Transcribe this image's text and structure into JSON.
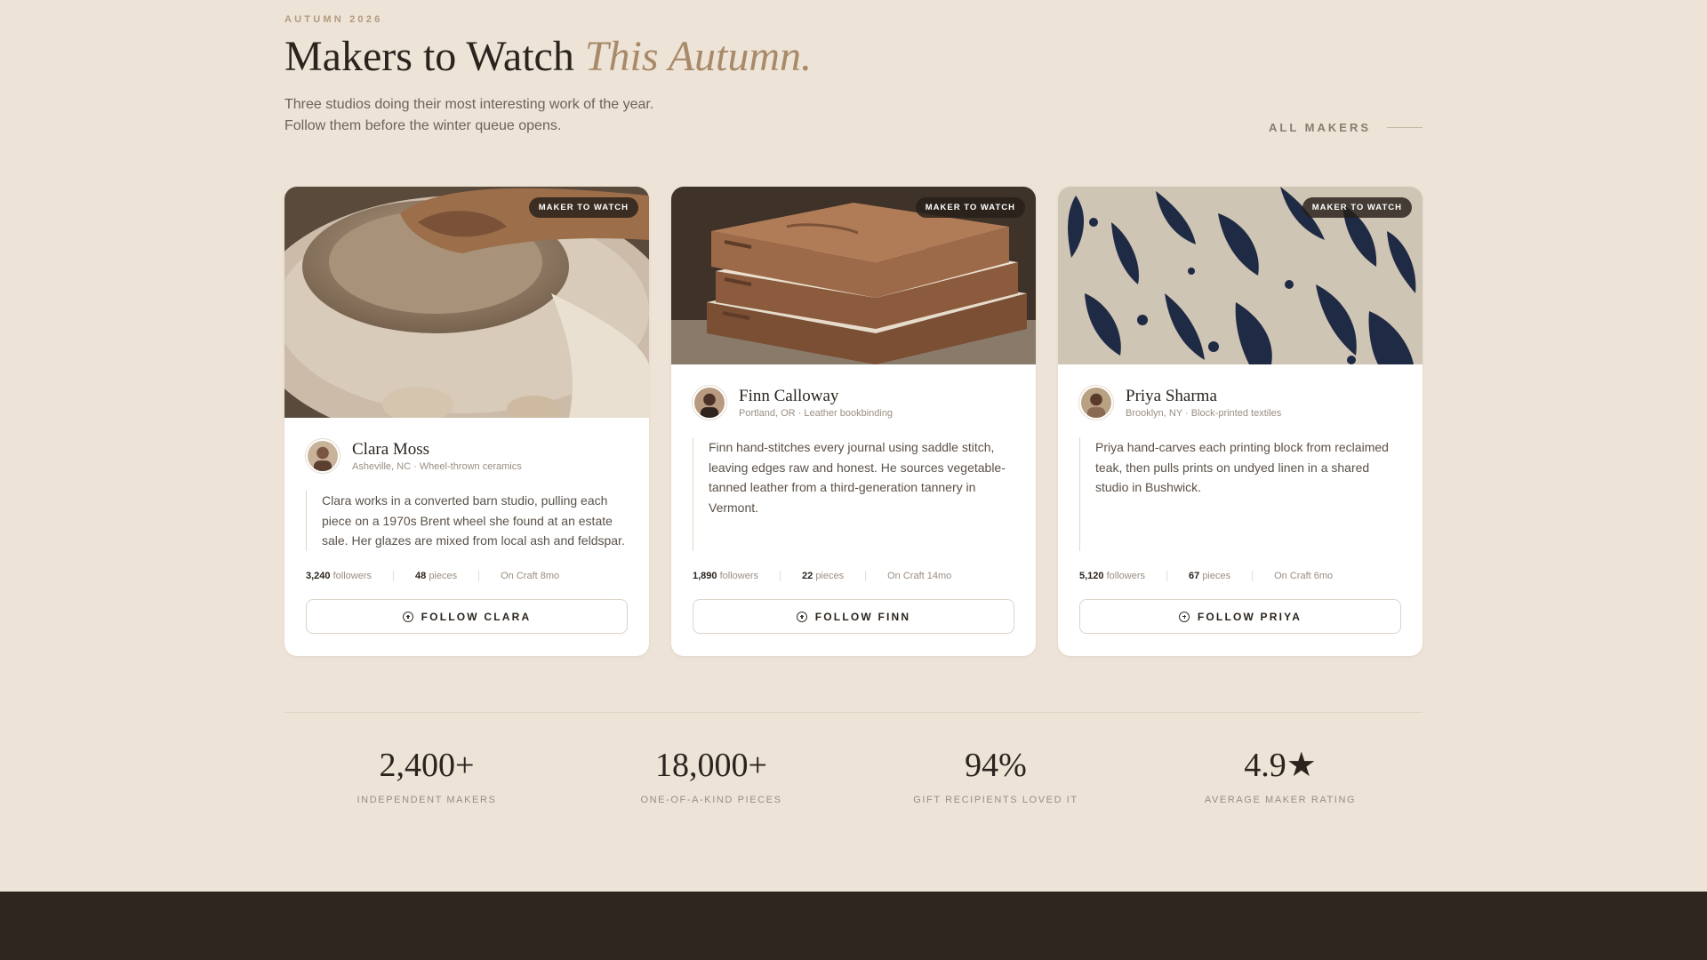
{
  "header": {
    "eyebrow": "AUTUMN 2026",
    "title_main": "Makers to Watch",
    "title_accent": "This Autumn.",
    "subtitle_line1": "Three studios doing their most interesting work of the year.",
    "subtitle_line2": "Follow them before the winter queue opens.",
    "all_makers_label": "ALL MAKERS"
  },
  "cards": [
    {
      "badge": "MAKER TO WATCH",
      "image": "pottery-wheel-photo",
      "name": "Clara Moss",
      "meta": "Asheville, NC · Wheel-thrown ceramics",
      "quote": "Clara works in a converted barn studio, pulling each piece on a 1970s Brent wheel she found at an estate sale. Her glazes are mixed from local ash and feldspar.",
      "followers": "3,240",
      "followers_label": "followers",
      "pieces": "48",
      "pieces_label": "pieces",
      "tenure": "On Craft 8mo",
      "follow_label": "FOLLOW CLARA"
    },
    {
      "badge": "MAKER TO WATCH",
      "image": "leather-books-photo",
      "name": "Finn Calloway",
      "meta": "Portland, OR · Leather bookbinding",
      "quote": "Finn hand-stitches every journal using saddle stitch, leaving edges raw and honest. He sources vegetable-tanned leather from a third-generation tannery in Vermont.",
      "followers": "1,890",
      "followers_label": "followers",
      "pieces": "22",
      "pieces_label": "pieces",
      "tenure": "On Craft 14mo",
      "follow_label": "FOLLOW FINN"
    },
    {
      "badge": "MAKER TO WATCH",
      "image": "block-print-fabric-photo",
      "name": "Priya Sharma",
      "meta": "Brooklyn, NY · Block-printed textiles",
      "quote": "Priya hand-carves each printing block from reclaimed teak, then pulls prints on undyed linen in a shared studio in Bushwick.",
      "followers": "5,120",
      "followers_label": "followers",
      "pieces": "67",
      "pieces_label": "pieces",
      "tenure": "On Craft 6mo",
      "follow_label": "FOLLOW PRIYA"
    }
  ],
  "metrics": [
    {
      "value": "2,400+",
      "label": "INDEPENDENT MAKERS"
    },
    {
      "value": "18,000+",
      "label": "ONE-OF-A-KIND PIECES"
    },
    {
      "value": "94%",
      "label": "GIFT RECIPIENTS LOVED IT"
    },
    {
      "value": "4.9★",
      "label": "AVERAGE MAKER RATING"
    }
  ],
  "colors": {
    "background": "#ede3d6",
    "accent": "#a88a69",
    "footer": "#2f2620",
    "text": "#2b241e"
  }
}
